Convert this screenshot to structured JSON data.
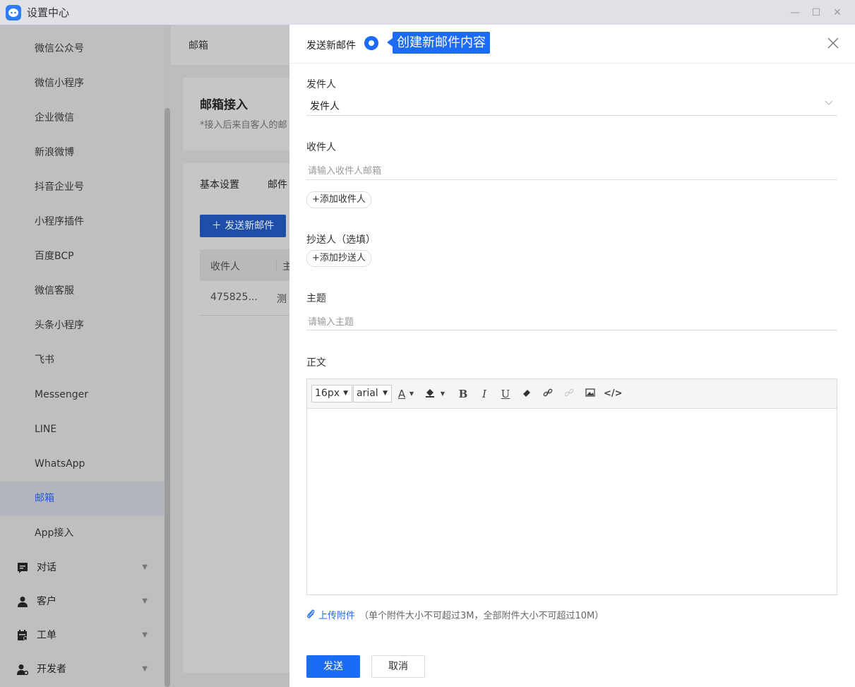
{
  "window": {
    "title": "设置中心",
    "controls": {
      "minimize": "—",
      "maximize": "☐",
      "close": "✕"
    }
  },
  "sidebar": {
    "items": [
      {
        "label": "微信公众号"
      },
      {
        "label": "微信小程序"
      },
      {
        "label": "企业微信"
      },
      {
        "label": "新浪微博"
      },
      {
        "label": "抖音企业号"
      },
      {
        "label": "小程序插件"
      },
      {
        "label": "百度BCP"
      },
      {
        "label": "微信客服"
      },
      {
        "label": "头条小程序"
      },
      {
        "label": "飞书"
      },
      {
        "label": "Messenger"
      },
      {
        "label": "LINE"
      },
      {
        "label": "WhatsApp"
      },
      {
        "label": "邮箱",
        "active": true
      },
      {
        "label": "App接入"
      }
    ],
    "groups": [
      {
        "label": "对话",
        "icon": "chat-icon"
      },
      {
        "label": "客户",
        "icon": "user-icon"
      },
      {
        "label": "工单",
        "icon": "ticket-icon"
      },
      {
        "label": "开发者",
        "icon": "developer-icon"
      }
    ]
  },
  "main": {
    "breadcrumb": "邮箱",
    "card_title": "邮箱接入",
    "card_subtitle": "*接入后来自客人的邮",
    "tabs": [
      "基本设置",
      "邮件"
    ],
    "new_mail_button": "发送新邮件",
    "table": {
      "headers": [
        "收件人",
        "主"
      ],
      "rows": [
        [
          "475825...",
          "测"
        ]
      ]
    }
  },
  "drawer": {
    "title": "发送新邮件",
    "tip": "创建新邮件内容",
    "sender": {
      "label": "发件人",
      "value": "发件人"
    },
    "recipient": {
      "label": "收件人",
      "placeholder": "请输入收件人邮箱",
      "add": "+添加收件人"
    },
    "cc": {
      "label": "抄送人（选填）",
      "add": "+添加抄送人"
    },
    "subject": {
      "label": "主题",
      "placeholder": "请输入主题"
    },
    "body": {
      "label": "正文",
      "toolbar": {
        "font_size": "16px",
        "font_family": "arial",
        "buttons": [
          "text-color-icon",
          "fill-color-icon",
          "bold-icon",
          "italic-icon",
          "underline-icon",
          "eraser-icon",
          "link-icon",
          "unlink-icon",
          "image-icon",
          "code-icon"
        ],
        "bold": "B",
        "italic": "I",
        "underline": "U",
        "text_color": "A",
        "code": "</>"
      }
    },
    "attachment": {
      "link": "上传附件",
      "note": "（单个附件大小不可超过3M，全部附件大小不可超过10M）"
    },
    "send_label": "发送",
    "cancel_label": "取消"
  },
  "colors": {
    "accent": "#1c6bf5",
    "active_nav": "#1d5bd6"
  }
}
